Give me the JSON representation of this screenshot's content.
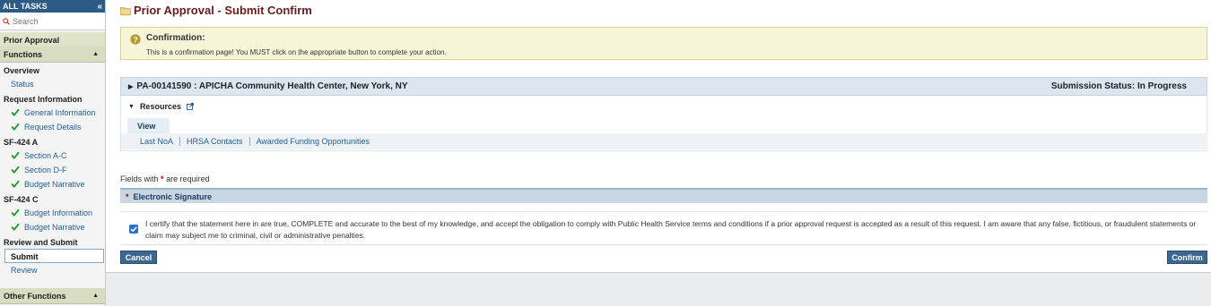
{
  "sidebar": {
    "header": "ALL TASKS",
    "collapse_label": "«",
    "search_placeholder": "Search",
    "context": "Prior Approval",
    "functions_label": "Functions",
    "groups": [
      {
        "label": "Overview",
        "items": [
          {
            "label": "Status",
            "checked": false
          }
        ]
      },
      {
        "label": "Request Information",
        "items": [
          {
            "label": "General Information",
            "checked": true
          },
          {
            "label": "Request Details",
            "checked": true
          }
        ]
      },
      {
        "label": "SF-424 A",
        "items": [
          {
            "label": "Section A-C",
            "checked": true
          },
          {
            "label": "Section D-F",
            "checked": true
          },
          {
            "label": "Budget Narrative",
            "checked": true
          }
        ]
      },
      {
        "label": "SF-424 C",
        "items": [
          {
            "label": "Budget Information",
            "checked": true
          },
          {
            "label": "Budget Narrative",
            "checked": true
          }
        ]
      },
      {
        "label": "Review and Submit",
        "items": [
          {
            "label": "Submit",
            "checked": false,
            "active": true
          },
          {
            "label": "Review",
            "checked": false
          }
        ]
      }
    ],
    "other_functions_label": "Other Functions"
  },
  "main": {
    "page_title": "Prior Approval - Submit Confirm",
    "confirmation": {
      "title": "Confirmation:",
      "text": "This is a confirmation page! You MUST click on the appropriate button to complete your action."
    },
    "pa_bar": {
      "title": "PA-00141590 : APICHA Community Health Center, New York, NY",
      "status": "Submission Status: In Progress"
    },
    "resources": {
      "label": "Resources",
      "tab": "View",
      "links": [
        "Last NoA",
        "HRSA Contacts",
        "Awarded Funding Opportunities"
      ]
    },
    "fields_note_prefix": "Fields with",
    "fields_note_star": "*",
    "fields_note_suffix": "are required",
    "esig": {
      "star": "*",
      "label": "Electronic Signature"
    },
    "certification": {
      "checked": true,
      "text": "I certify that the statement here in are true, COMPLETE and accurate to the best of my knowledge, and accept the obligation to comply with Public Health Service terms and conditions if a prior approval request is accepted as a result of this request. I am aware that any false, fictitious, or fraudulent statements or claim may subject me to criminal, civil or administrative penalties."
    },
    "buttons": {
      "cancel": "Cancel",
      "confirm": "Confirm"
    }
  },
  "colors": {
    "sidebar_header": "#2c5c85",
    "title": "#6a1b1b",
    "link": "#1f5d99",
    "button": "#3c6790",
    "confirmation_bg": "#f7f5d8"
  }
}
